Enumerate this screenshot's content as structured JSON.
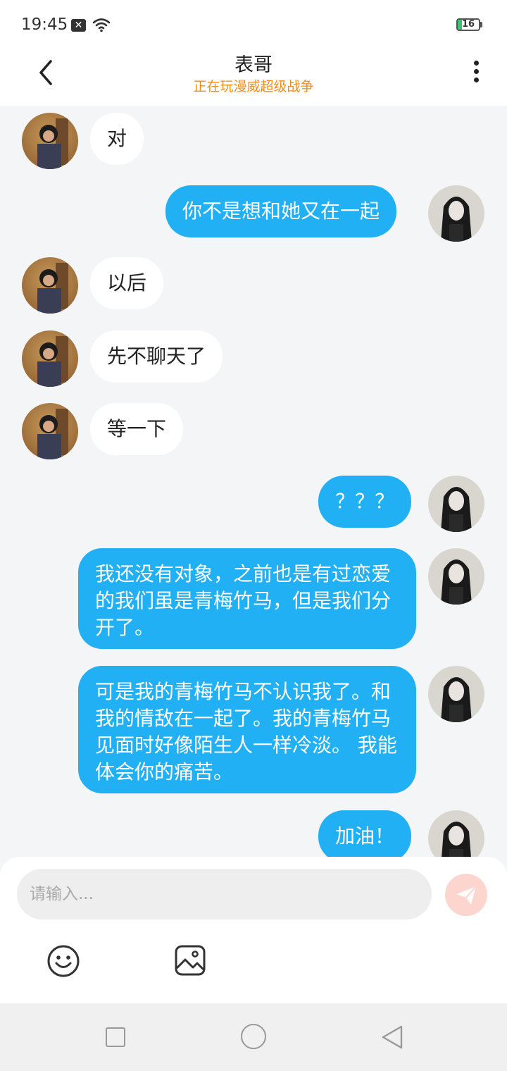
{
  "status_bar": {
    "time": "19:45",
    "notification_glyph": "✕",
    "battery": "16"
  },
  "header": {
    "title": "表哥",
    "subtitle": "正在玩漫威超级战争"
  },
  "messages": [
    {
      "side": "left",
      "text": "对"
    },
    {
      "side": "right",
      "text": "你不是想和她又在一起"
    },
    {
      "side": "left",
      "text": "以后"
    },
    {
      "side": "left",
      "text": "先不聊天了"
    },
    {
      "side": "left",
      "text": "等一下"
    },
    {
      "side": "right",
      "text": "？？？"
    },
    {
      "side": "right",
      "text": "我还没有对象，之前也是有过恋爱的我们虽是青梅竹马，但是我们分开了。"
    },
    {
      "side": "right",
      "text": "可是我的青梅竹马不认识我了。和我的情敌在一起了。我的青梅竹马见面时好像陌生人一样冷淡。 我能体会你的痛苦。"
    },
    {
      "side": "right",
      "text": "加油！"
    }
  ],
  "input": {
    "placeholder": "请输入..."
  },
  "icons": {
    "back": "chevron-left-icon",
    "more": "more-vertical-icon",
    "send": "send-icon",
    "emoji": "emoji-icon",
    "image": "image-icon"
  },
  "colors": {
    "accent": "#22b0f5",
    "subtitle": "#f08c1a",
    "send": "#fdd5cf"
  }
}
